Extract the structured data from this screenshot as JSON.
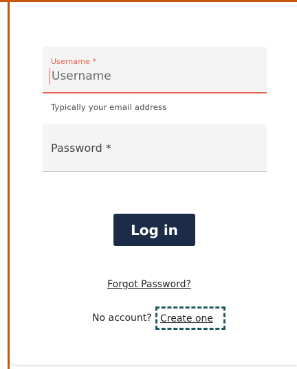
{
  "form": {
    "username_label": "Username *",
    "username_placeholder": "Username",
    "username_value": "",
    "helper_text": "Typically your email address",
    "password_label": "Password *",
    "login_label": "Log in",
    "forgot_password_label": "Forgot Password?",
    "no_account_text": "No account?",
    "create_account_label": "Create one"
  },
  "colors": {
    "accent_frame": "#c9570d",
    "error_red": "#e8624e",
    "button_navy": "#1c2b48",
    "focus_outline": "#1b5a5f"
  }
}
